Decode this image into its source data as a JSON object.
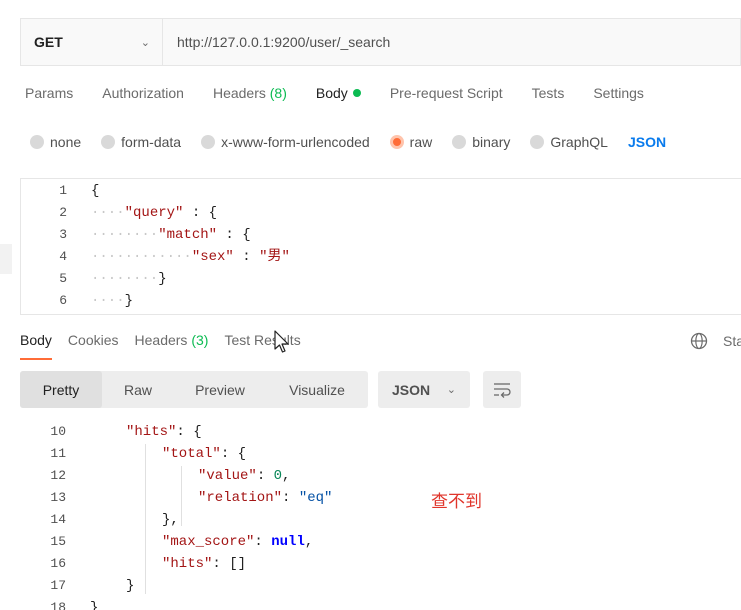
{
  "request": {
    "method": "GET",
    "url": "http://127.0.0.1:9200/user/_search"
  },
  "request_tabs": {
    "params": "Params",
    "authorization": "Authorization",
    "headers": "Headers",
    "headers_count": "(8)",
    "body": "Body",
    "pre_request": "Pre-request Script",
    "tests": "Tests",
    "settings": "Settings"
  },
  "body_types": {
    "none": "none",
    "form_data": "form-data",
    "urlencoded": "x-www-form-urlencoded",
    "raw": "raw",
    "binary": "binary",
    "graphql": "GraphQL",
    "format": "JSON",
    "selected": "raw"
  },
  "request_body": {
    "line_numbers": [
      "1",
      "2",
      "3",
      "4",
      "5",
      "6"
    ],
    "l1": "{",
    "l2_key": "\"query\"",
    "l2_rest": " : {",
    "l3_key": "\"match\"",
    "l3_rest": " : {",
    "l4_key": "\"sex\"",
    "l4_sep": " : ",
    "l4_val": "\"男\"",
    "l5": "}",
    "l6": "}"
  },
  "response_tabs": {
    "body": "Body",
    "cookies": "Cookies",
    "headers": "Headers",
    "headers_count": "(3)",
    "test_results": "Test Results",
    "status_partial": "Sta"
  },
  "response_toolbar": {
    "pretty": "Pretty",
    "raw": "Raw",
    "preview": "Preview",
    "visualize": "Visualize",
    "format": "JSON"
  },
  "response_body": {
    "line_numbers": [
      "10",
      "11",
      "12",
      "13",
      "14",
      "15",
      "16",
      "17",
      "18"
    ],
    "l10_key": "\"hits\"",
    "l10_rest": ": {",
    "l11_key": "\"total\"",
    "l11_rest": ": {",
    "l12_key": "\"value\"",
    "l12_sep": ": ",
    "l12_val": "0",
    "l12_end": ",",
    "l13_key": "\"relation\"",
    "l13_sep": ": ",
    "l13_val": "\"eq\"",
    "l14": "},",
    "l15_key": "\"max_score\"",
    "l15_sep": ": ",
    "l15_val": "null",
    "l15_end": ",",
    "l16_key": "\"hits\"",
    "l16_rest": ": []",
    "l17": "}",
    "l18": "}"
  },
  "annotation": "查不到",
  "colors": {
    "accent": "#ff6c37",
    "green": "#0cbb52",
    "link": "#097bed",
    "annotation": "#e0352b"
  },
  "icons": {
    "method_dropdown": "chevron-down-icon",
    "globe": "globe-icon",
    "wrap": "wrap-lines-icon",
    "cursor": "mouse-cursor-icon"
  }
}
